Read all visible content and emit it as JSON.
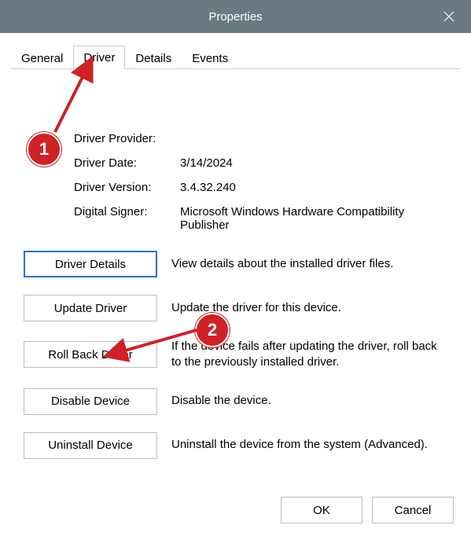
{
  "window": {
    "title": "Properties"
  },
  "tabs": [
    "General",
    "Driver",
    "Details",
    "Events"
  ],
  "info": {
    "providerLabel": "Driver Provider:",
    "providerValue": "",
    "dateLabel": "Driver Date:",
    "dateValue": "3/14/2024",
    "versionLabel": "Driver Version:",
    "versionValue": "3.4.32.240",
    "signerLabel": "Digital Signer:",
    "signerValue": "Microsoft Windows Hardware Compatibility Publisher"
  },
  "buttons": {
    "details": "Driver Details",
    "detailsDesc": "View details about the installed driver files.",
    "update": "Update Driver",
    "updateDesc": "Update the driver for this device.",
    "rollback": "Roll Back Driver",
    "rollbackDesc": "If the device fails after updating the driver, roll back to the previously installed driver.",
    "disable": "Disable Device",
    "disableDesc": "Disable the device.",
    "uninstall": "Uninstall Device",
    "uninstallDesc": "Uninstall the device from the system (Advanced)."
  },
  "footer": {
    "ok": "OK",
    "cancel": "Cancel"
  },
  "markers": {
    "one": "1",
    "two": "2"
  }
}
